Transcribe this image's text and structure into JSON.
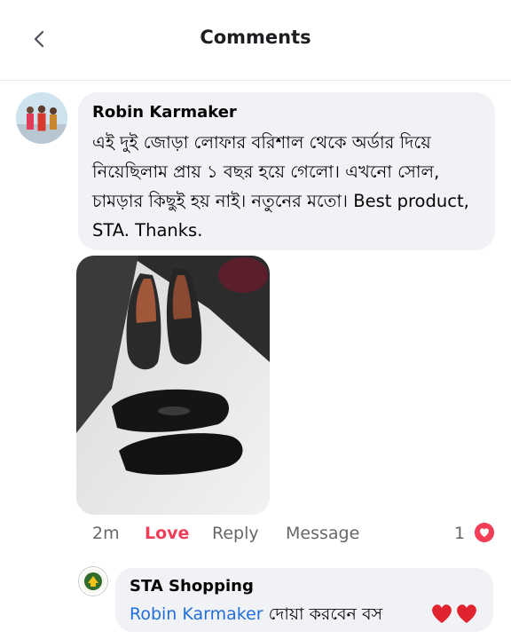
{
  "header": {
    "title": "Comments"
  },
  "comment": {
    "author": "Robin Karmaker",
    "text": "এই দুই জোড়া লোফার বরিশাল থেকে অর্ডার দিয়ে নিয়েছিলাম প্রায় ১ বছর হয়ে গেলো। এখনো সোল, চামড়ার কিছুই হয় নাই। নতুনের মতো। Best product,  STA. Thanks.",
    "time": "2m",
    "reaction_label": "Love",
    "reply_label": "Reply",
    "message_label": "Message",
    "reaction_count": "1",
    "reaction_color": "#f33e58",
    "reaction_active_color": "#f33e58"
  },
  "reply": {
    "author": "STA Shopping",
    "mention": "Robin Karmaker",
    "text": " দোয়া করবেন বস"
  },
  "icons": {
    "back": "chevron-left-icon",
    "love": "heart-icon"
  }
}
